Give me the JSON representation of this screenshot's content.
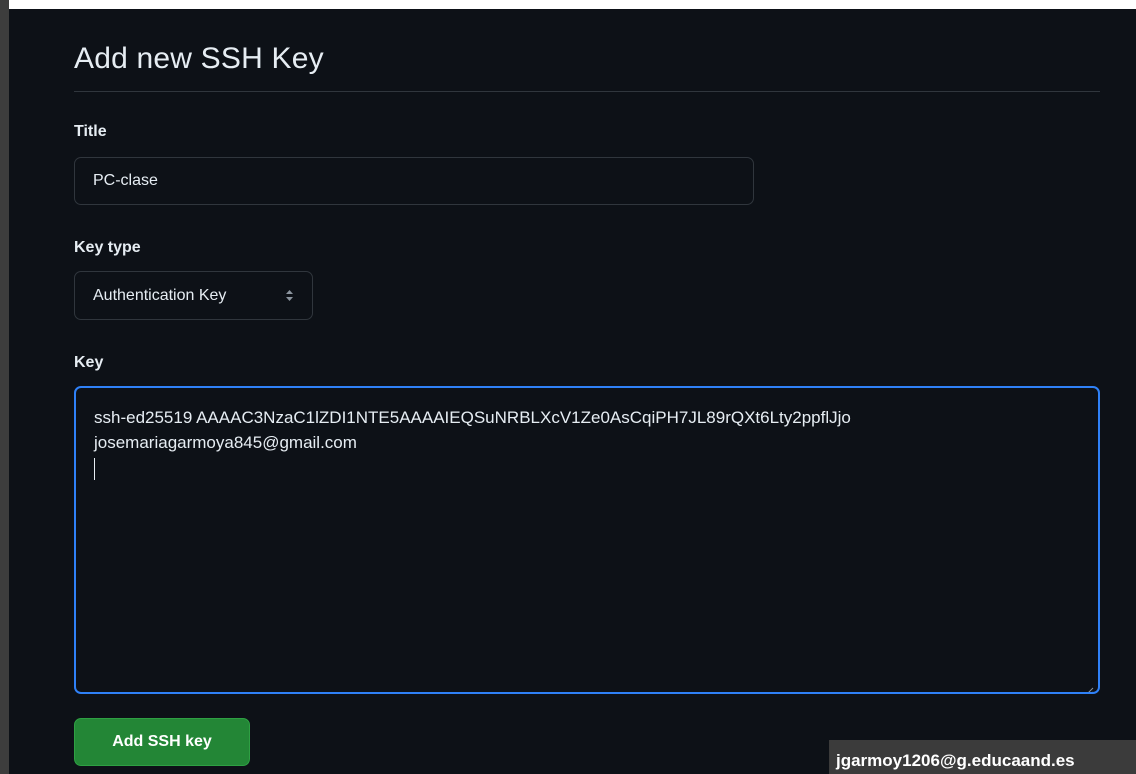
{
  "page": {
    "title": "Add new SSH Key"
  },
  "form": {
    "title_label": "Title",
    "title_value": "PC-clase",
    "key_type_label": "Key type",
    "key_type_value": "Authentication Key",
    "key_label": "Key",
    "key_lines": [
      "ssh-ed25519 AAAAC3NzaC1lZDI1NTE5AAAAIEQSuNRBLXcV1Ze0AsCqiPH7JL89rQXt6Lty2ppflJjo",
      "josemariagarmoya845@gmail.com"
    ],
    "submit_label": "Add SSH key"
  },
  "overlay": {
    "account_email": "jgarmoy1206@g.educaand.es"
  },
  "colors": {
    "background": "#0d1117",
    "border": "#30363d",
    "focus_border": "#2f81f7",
    "primary_button": "#238636",
    "text": "#e6edf3"
  },
  "icons": {
    "select_arrows": "chevron-up-down-icon",
    "textarea_resize": "resize-grip-icon"
  }
}
